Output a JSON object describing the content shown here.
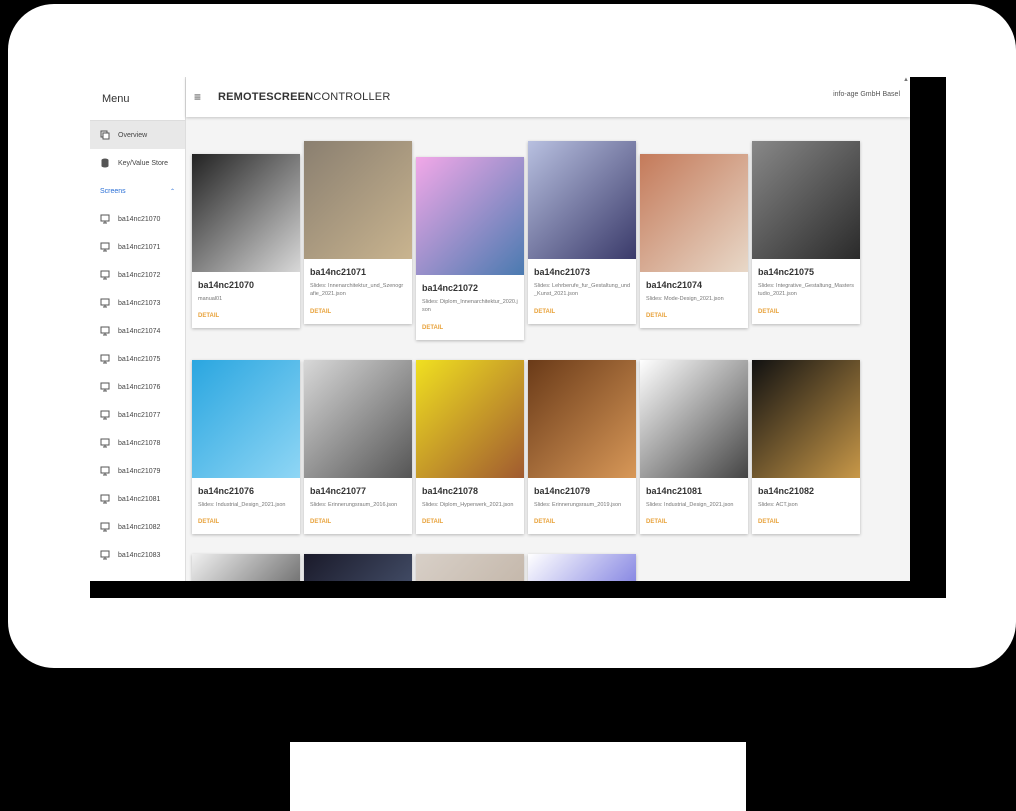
{
  "menu_title": "Menu",
  "app": {
    "brand_bold": "REMOTESCREEN",
    "brand_light": "CONTROLLER",
    "org": "info-age GmbH Basel",
    "hamburger": "≡"
  },
  "sidebar": {
    "items": [
      {
        "label": "Overview",
        "icon": "screens-icon",
        "active": true
      },
      {
        "label": "Key/Value Store",
        "icon": "database-icon",
        "active": false
      }
    ],
    "section_label": "Screens",
    "screens": [
      "ba14nc21070",
      "ba14nc21071",
      "ba14nc21072",
      "ba14nc21073",
      "ba14nc21074",
      "ba14nc21075",
      "ba14nc21076",
      "ba14nc21077",
      "ba14nc21078",
      "ba14nc21079",
      "ba14nc21081",
      "ba14nc21082",
      "ba14nc21083"
    ]
  },
  "cards": [
    {
      "title": "ba14nc21070",
      "subtitle": "manual01",
      "detail": "DETAIL",
      "colors": [
        "#222222",
        "#d8d8d8"
      ]
    },
    {
      "title": "ba14nc21071",
      "subtitle": "Slides: Innenarchitektur_und_Szenografie_2021.json",
      "detail": "DETAIL",
      "colors": [
        "#8a7f70",
        "#c9b48f"
      ]
    },
    {
      "title": "ba14nc21072",
      "subtitle": "Slides: Diplom_Innenarchitektur_2020.json",
      "detail": "DETAIL",
      "colors": [
        "#f2a8e8",
        "#4a7ab0"
      ]
    },
    {
      "title": "ba14nc21073",
      "subtitle": "Slides: Lehrberufe_fur_Gestaltung_und_Kunst_2021.json",
      "detail": "DETAIL",
      "colors": [
        "#b8c0e0",
        "#3a3a6a"
      ]
    },
    {
      "title": "ba14nc21074",
      "subtitle": "Slides: Mode-Design_2021.json",
      "detail": "DETAIL",
      "colors": [
        "#c47a5a",
        "#e8d8c8"
      ]
    },
    {
      "title": "ba14nc21075",
      "subtitle": "Slides: Integrative_Gestaltung_Masterstudio_2021.json",
      "detail": "DETAIL",
      "colors": [
        "#888888",
        "#2a2a2a"
      ]
    },
    {
      "title": "ba14nc21076",
      "subtitle": "Slides: Industrial_Design_2021.json",
      "detail": "DETAIL",
      "colors": [
        "#2aa6e0",
        "#8fd6f5"
      ]
    },
    {
      "title": "ba14nc21077",
      "subtitle": "Slides: Erinnerungsraum_2016.json",
      "detail": "DETAIL",
      "colors": [
        "#d8d8d8",
        "#555555"
      ]
    },
    {
      "title": "ba14nc21078",
      "subtitle": "Slides: Diplom_Hyperwerk_2021.json",
      "detail": "DETAIL",
      "colors": [
        "#f0e020",
        "#a05a30"
      ]
    },
    {
      "title": "ba14nc21079",
      "subtitle": "Slides: Erinnerungsraum_2019.json",
      "detail": "DETAIL",
      "colors": [
        "#6a3a18",
        "#d89858"
      ]
    },
    {
      "title": "ba14nc21081",
      "subtitle": "Slides: Industrial_Design_2021.json",
      "detail": "DETAIL",
      "colors": [
        "#ffffff",
        "#444444"
      ]
    },
    {
      "title": "ba14nc21082",
      "subtitle": "Slides: ACT.json",
      "detail": "DETAIL",
      "colors": [
        "#111111",
        "#c89848"
      ]
    },
    {
      "title": "",
      "subtitle": "",
      "detail": "",
      "colors": [
        "#f0f0f0",
        "#222222"
      ]
    },
    {
      "title": "",
      "subtitle": "",
      "detail": "",
      "colors": [
        "#1a1a2a",
        "#5a6a8a"
      ]
    },
    {
      "title": "",
      "subtitle": "",
      "detail": "",
      "colors": [
        "#d8d0c8",
        "#b8a898"
      ]
    },
    {
      "title": "",
      "subtitle": "",
      "detail": "",
      "colors": [
        "#ffffff",
        "#3a3ad0"
      ]
    }
  ]
}
